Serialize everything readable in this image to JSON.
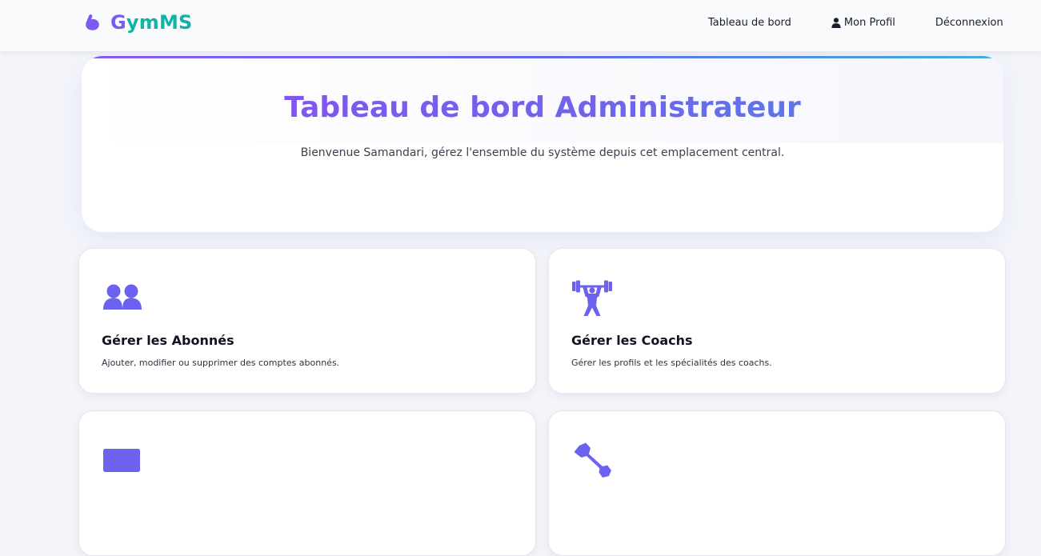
{
  "navbar": {
    "brand": {
      "prefix": "G",
      "rest": "ymMS"
    },
    "links": [
      {
        "label": "Tableau de bord"
      },
      {
        "label": "Mon Profil"
      },
      {
        "label": "Déconnexion"
      }
    ]
  },
  "hero": {
    "title": "Tableau de bord Administrateur",
    "subtitle": "Bienvenue Samandari, gérez l'ensemble du système depuis cet emplacement central."
  },
  "cards": [
    {
      "title": "Gérer les Abonnés",
      "description": "Ajouter, modifier ou supprimer des comptes abonnés.",
      "icon": "users-icon"
    },
    {
      "title": "Gérer les Coachs",
      "description": "Gérer les profils et les spécialités des coachs.",
      "icon": "weightlifter-icon"
    },
    {
      "title": "",
      "description": "",
      "icon": "card-icon"
    },
    {
      "title": "",
      "description": "",
      "icon": "wrench-icon"
    }
  ],
  "colors": {
    "accent": "#6c5ce7",
    "brand_teal": "#12b3a7",
    "brand_purple": "#7c5cf0",
    "icon": "#6d62ef"
  }
}
